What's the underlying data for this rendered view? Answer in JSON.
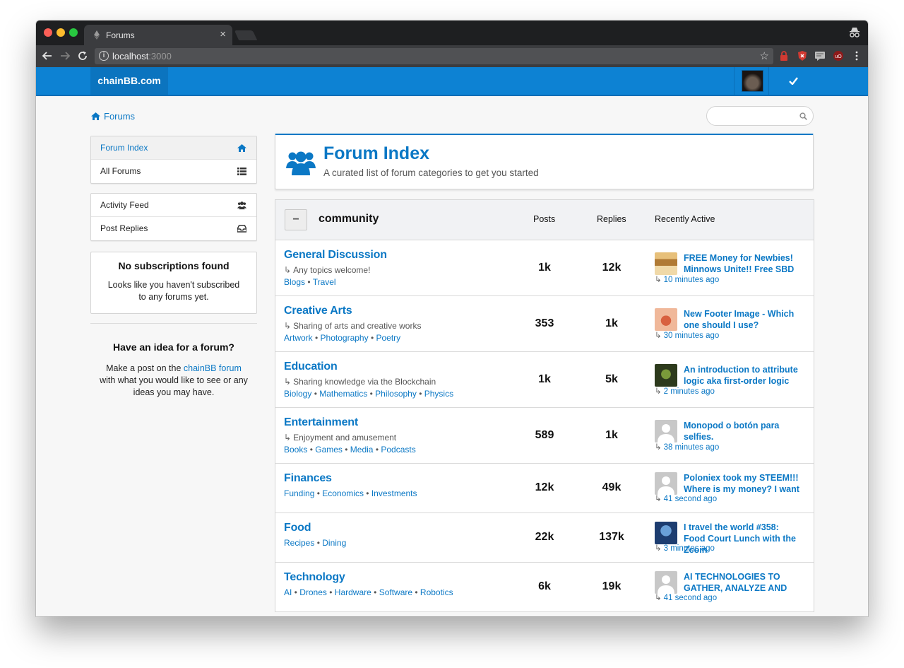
{
  "browser": {
    "tab_title": "Forums",
    "url_host": "localhost",
    "url_port": ":3000"
  },
  "navbar": {
    "brand": "chainBB.com",
    "check_icon": "check-icon"
  },
  "breadcrumb": {
    "label": "Forums"
  },
  "search": {
    "placeholder": ""
  },
  "sidebar": {
    "menu_top": [
      {
        "label": "Forum Index",
        "icon": "home-icon"
      },
      {
        "label": "All Forums",
        "icon": "list-icon"
      }
    ],
    "menu_activity": [
      {
        "label": "Activity Feed",
        "icon": "users-icon"
      },
      {
        "label": "Post Replies",
        "icon": "inbox-icon"
      }
    ],
    "subscriptions": {
      "title": "No subscriptions found",
      "text": "Looks like you haven't subscribed to any forums yet."
    },
    "idea": {
      "title": "Have an idea for a forum?",
      "text_before": "Make a post on the ",
      "link": "chainBB forum",
      "text_after": " with what you would like to see or any ideas you may have."
    }
  },
  "header": {
    "title": "Forum Index",
    "subtitle": "A curated list of forum categories to get you started"
  },
  "table": {
    "category": "community",
    "collapse_label": "−",
    "columns": {
      "posts": "Posts",
      "replies": "Replies",
      "recent": "Recently Active"
    },
    "rows": [
      {
        "name": "General Discussion",
        "desc": "Any topics welcome!",
        "tags": [
          "Blogs",
          "Travel"
        ],
        "posts": "1k",
        "replies": "12k",
        "recent_title": "FREE Money for Newbies! Minnows Unite!! Free SBD",
        "recent_time": "10 minutes ago"
      },
      {
        "name": "Creative Arts",
        "desc": "Sharing of arts and creative works",
        "tags": [
          "Artwork",
          "Photography",
          "Poetry"
        ],
        "posts": "353",
        "replies": "1k",
        "recent_title": "New Footer Image - Which one should I use?",
        "recent_time": "30 minutes ago"
      },
      {
        "name": "Education",
        "desc": "Sharing knowledge via the Blockchain",
        "tags": [
          "Biology",
          "Mathematics",
          "Philosophy",
          "Physics"
        ],
        "posts": "1k",
        "replies": "5k",
        "recent_title": "An introduction to attribute logic aka first-order logic",
        "recent_time": "2 minutes ago"
      },
      {
        "name": "Entertainment",
        "desc": "Enjoyment and amusement",
        "tags": [
          "Books",
          "Games",
          "Media",
          "Podcasts"
        ],
        "posts": "589",
        "replies": "1k",
        "recent_title": "Monopod o botón para selfies.",
        "recent_time": "38 minutes ago"
      },
      {
        "name": "Finances",
        "desc": "",
        "tags": [
          "Funding",
          "Economics",
          "Investments"
        ],
        "posts": "12k",
        "replies": "49k",
        "recent_title": "Poloniex took my STEEM!!! Where is my money? I want",
        "recent_time": "41 second ago"
      },
      {
        "name": "Food",
        "desc": "",
        "tags": [
          "Recipes",
          "Dining"
        ],
        "posts": "22k",
        "replies": "137k",
        "recent_title": "I travel the world #358: Food Court Lunch with the Zcoin",
        "recent_time": "3 minutes ago"
      },
      {
        "name": "Technology",
        "desc": "",
        "tags": [
          "AI",
          "Drones",
          "Hardware",
          "Software",
          "Robotics"
        ],
        "posts": "6k",
        "replies": "19k",
        "recent_title": "AI TECHNOLOGIES TO GATHER, ANALYZE AND",
        "recent_time": "41 second ago"
      }
    ]
  },
  "colors": {
    "brand_blue": "#0d82d3",
    "link_blue": "#0b78c5"
  }
}
